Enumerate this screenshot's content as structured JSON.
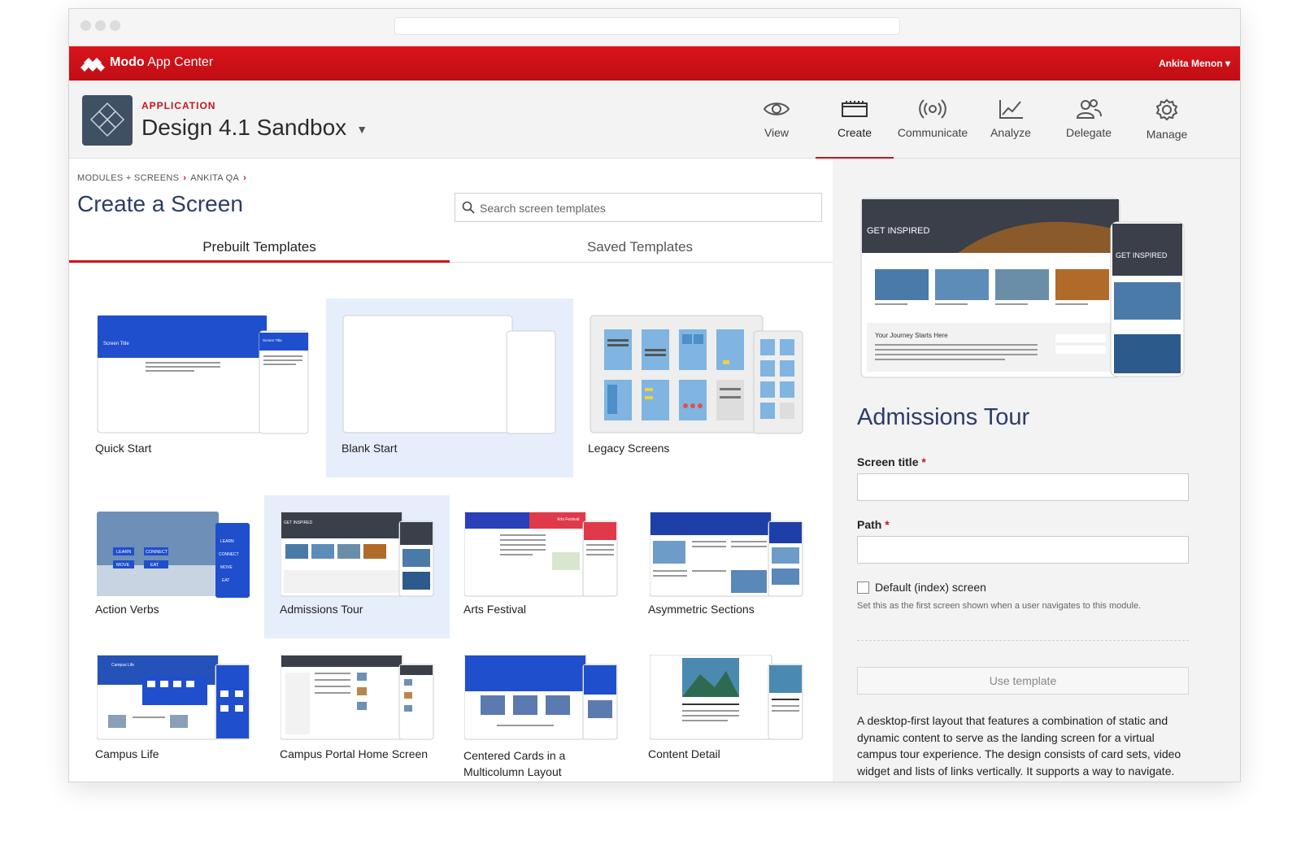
{
  "topbar": {
    "brand_bold": "Modo",
    "brand_rest": " App Center",
    "user": "Ankita Menon"
  },
  "app": {
    "label": "APPLICATION",
    "name": "Design 4.1 Sandbox"
  },
  "nav": [
    {
      "label": "View"
    },
    {
      "label": "Create"
    },
    {
      "label": "Communicate"
    },
    {
      "label": "Analyze"
    },
    {
      "label": "Delegate"
    },
    {
      "label": "Manage"
    }
  ],
  "breadcrumb": {
    "item1": "MODULES + SCREENS",
    "item2": "ANKITA QA"
  },
  "page": {
    "title": "Create a Screen",
    "search_placeholder": "Search screen templates"
  },
  "tabs": {
    "prebuilt": "Prebuilt Templates",
    "saved": "Saved Templates"
  },
  "templates": [
    {
      "label": "Quick Start"
    },
    {
      "label": "Blank Start"
    },
    {
      "label": "Legacy Screens"
    },
    {
      "label": "Action Verbs"
    },
    {
      "label": "Admissions Tour"
    },
    {
      "label": "Arts Festival"
    },
    {
      "label": "Asymmetric Sections"
    },
    {
      "label": "Campus Life"
    },
    {
      "label": "Campus Portal Home Screen"
    },
    {
      "label": "Centered Cards in a Multicolumn Layout"
    },
    {
      "label": "Content Detail"
    }
  ],
  "thumb_text": {
    "screen_title": "Screen Title",
    "get_inspired": "GET INSPIRED",
    "journey": "Your Journey Starts Here",
    "arts": "Arts Festival",
    "campus_life": "Campus Life",
    "learn": "LEARN",
    "connect": "CONNECT",
    "move": "MOVE",
    "eat": "EAT"
  },
  "detail": {
    "title": "Admissions Tour",
    "screen_title_label": "Screen title",
    "path_label": "Path",
    "required_mark": "*",
    "default_label": "Default (index) screen",
    "help": "Set this as the first screen shown when a user navigates to this module.",
    "use_button": "Use template",
    "description": "A desktop-first layout that features a combination of static and dynamic content to serve as the landing screen for a virtual campus tour experience. The design consists of card sets, video widget and lists of links vertically. It supports a way to navigate. This design will create a virtual tour."
  },
  "colors": {
    "brand_red": "#c8141b",
    "title_navy": "#2d3b6a",
    "selected_bg": "#e6eefb"
  }
}
